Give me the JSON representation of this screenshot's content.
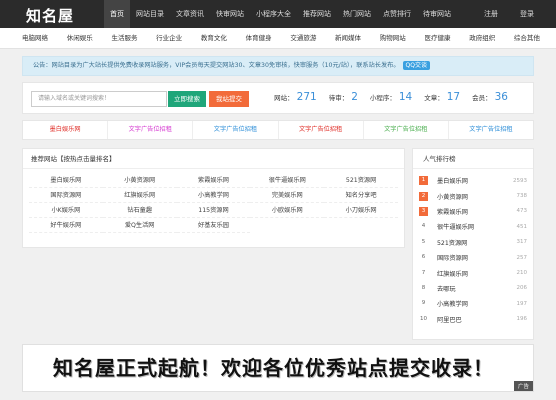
{
  "header": {
    "logo": "知名屋",
    "nav": [
      "首页",
      "网站目录",
      "文章资讯",
      "快审网站",
      "小程序大全",
      "推荐网站",
      "热门网站",
      "点赞排行",
      "待审网站"
    ],
    "login": "注册",
    "register": "登录"
  },
  "categories": [
    "电脑网络",
    "休闲娱乐",
    "生活服务",
    "行业企业",
    "教育文化",
    "体育健身",
    "交通旅游",
    "新闻媒体",
    "购物网站",
    "医疗健康",
    "政府组织",
    "综合其他"
  ],
  "notice": {
    "text": "公告：网站目录为广大站长提供免费收录网站服务，VIP会员每天提交网站30、文章30免审核，快审服务（10元/站），联系站长发布。",
    "qq_label": "QQ交谈"
  },
  "search": {
    "placeholder": "请输入域名或关键词搜索！",
    "button": "立即搜索",
    "submit": "我站提交"
  },
  "stats": [
    {
      "label": "网站：",
      "value": "271"
    },
    {
      "label": "待审：",
      "value": "2"
    },
    {
      "label": "小程序：",
      "value": "14"
    },
    {
      "label": "文章：",
      "value": "17"
    },
    {
      "label": "会员：",
      "value": "36"
    }
  ],
  "ads": [
    {
      "text": "墨白娱乐网",
      "color": "#e0302a"
    },
    {
      "text": "文字广告位招租",
      "color": "#d63bd1"
    },
    {
      "text": "文字广告位招租",
      "color": "#2f8fd8"
    },
    {
      "text": "文字广告位招租",
      "color": "#e0302a"
    },
    {
      "text": "文字广告位招租",
      "color": "#4caf50"
    },
    {
      "text": "文字广告位招租",
      "color": "#2f8fd8"
    }
  ],
  "recommend": {
    "title": "推荐网站【按热点击量排名】",
    "sites": [
      "墨白娱乐网",
      "小黄资源网",
      "紫霞娱乐网",
      "很牛逼娱乐网",
      "521资源网",
      "国际资源网",
      "红旗娱乐网",
      "小高教学网",
      "完美娱乐网",
      "知名分享吧",
      "小K娱乐网",
      "钻石童趣",
      "115资源网",
      "小欧娱乐网",
      "小刀娱乐网",
      "好牛娱乐网",
      "爱Q生活网",
      "好基友乐园"
    ]
  },
  "hot": {
    "title": "人气排行榜",
    "items": [
      {
        "rank": "1",
        "name": "墨白娱乐网",
        "count": "2593"
      },
      {
        "rank": "2",
        "name": "小黄资源网",
        "count": "738"
      },
      {
        "rank": "3",
        "name": "紫霞娱乐网",
        "count": "473"
      },
      {
        "rank": "4",
        "name": "很牛逼娱乐网",
        "count": "451"
      },
      {
        "rank": "5",
        "name": "521资源网",
        "count": "317"
      },
      {
        "rank": "6",
        "name": "国际资源网",
        "count": "257"
      },
      {
        "rank": "7",
        "name": "红旗娱乐网",
        "count": "210"
      },
      {
        "rank": "8",
        "name": "去哪玩",
        "count": "206"
      },
      {
        "rank": "9",
        "name": "小高教学网",
        "count": "197"
      },
      {
        "rank": "10",
        "name": "阿里巴巴",
        "count": "196"
      }
    ]
  },
  "banner": {
    "text": "知名屋正式起航！欢迎各位优秀站点提交收录！",
    "tag": "广告"
  }
}
